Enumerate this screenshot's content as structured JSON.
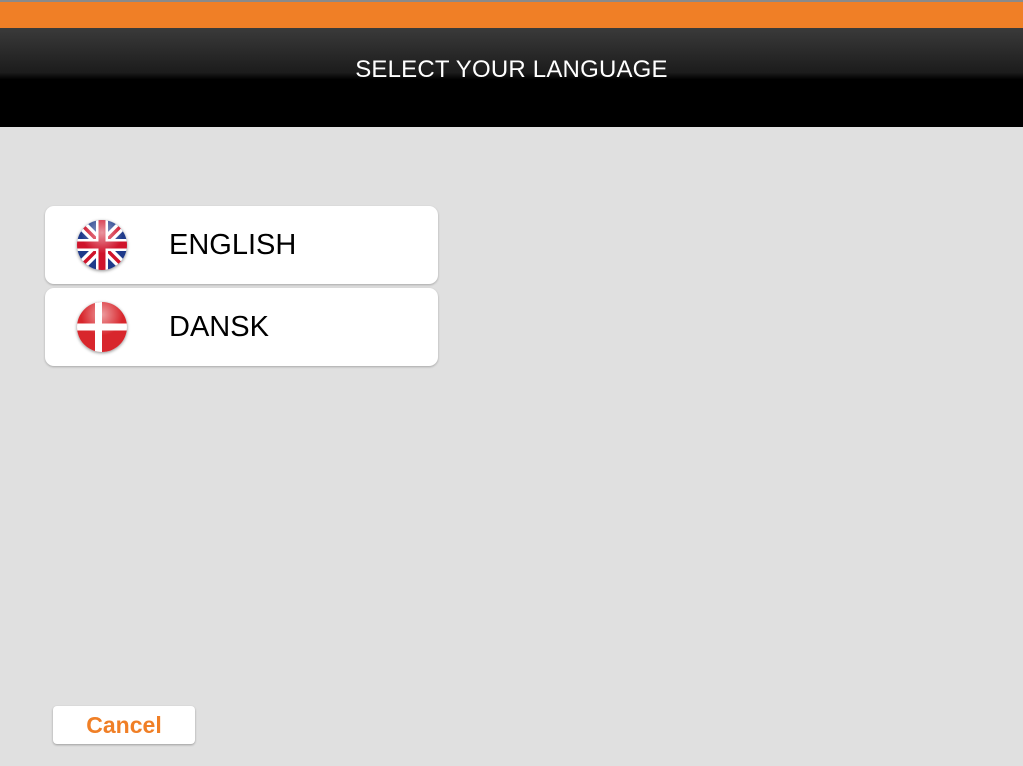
{
  "header": {
    "title": "SELECT YOUR LANGUAGE"
  },
  "languages": [
    {
      "label": "ENGLISH",
      "icon": "uk-flag-icon"
    },
    {
      "label": "DANSK",
      "icon": "denmark-flag-icon"
    }
  ],
  "footer": {
    "cancel_label": "Cancel"
  },
  "colors": {
    "accent": "#f07f26",
    "header_bg": "#000000",
    "page_bg": "#e0e0e0",
    "item_bg": "#ffffff"
  }
}
